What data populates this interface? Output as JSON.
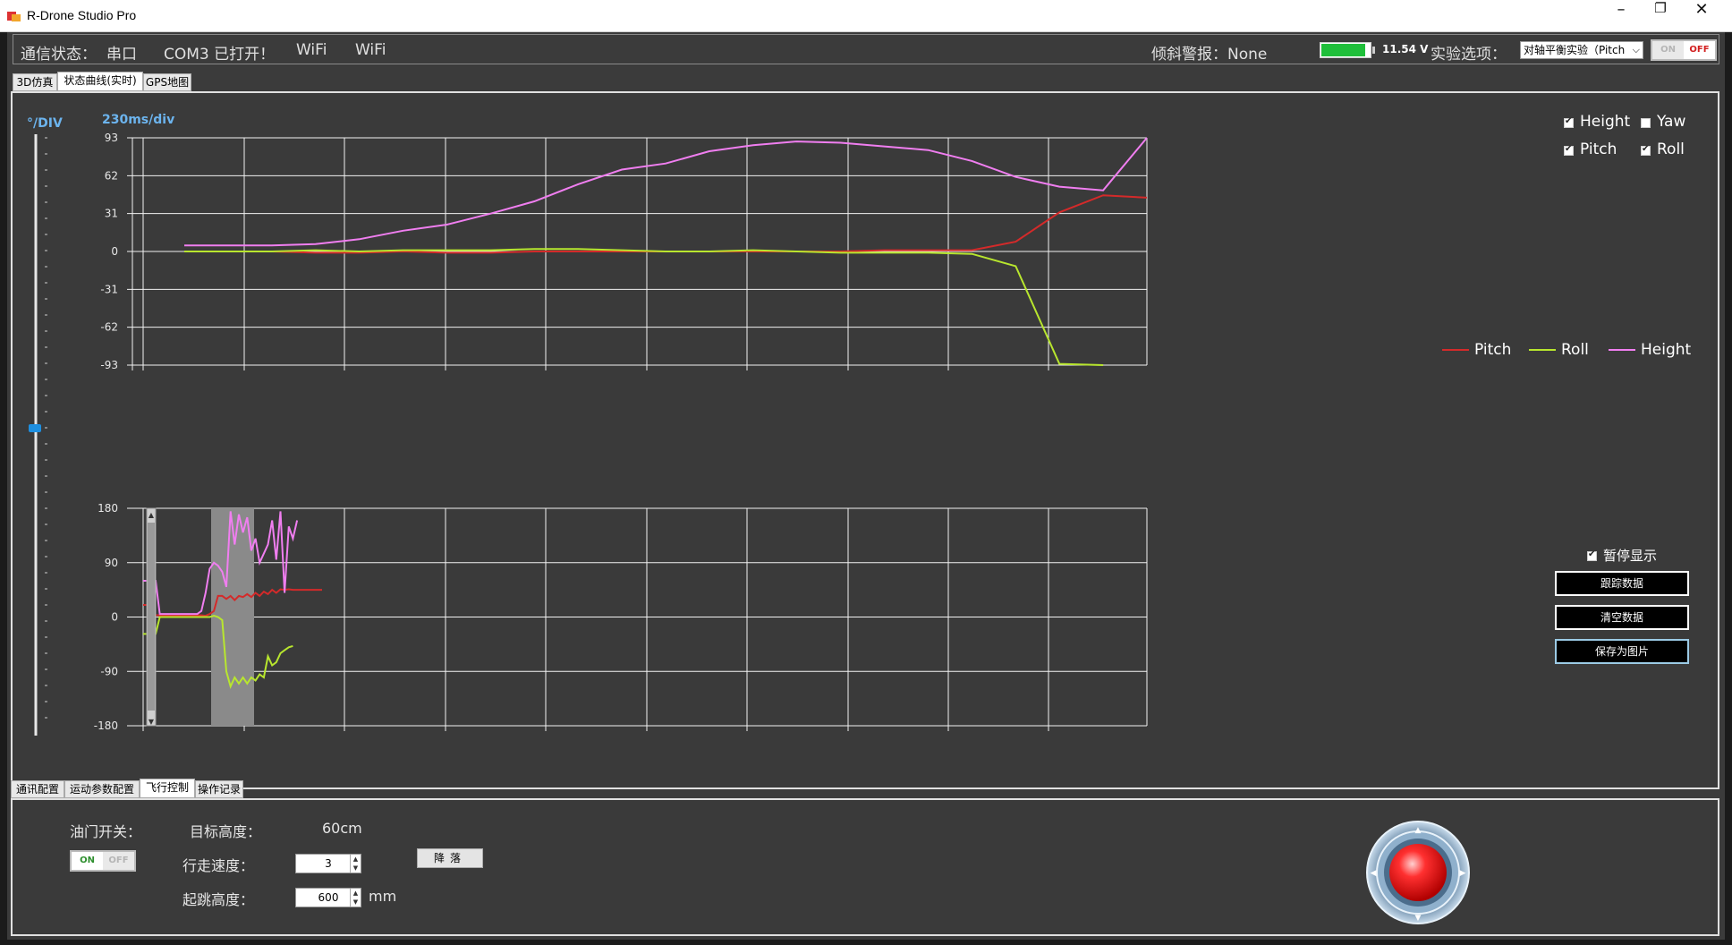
{
  "window": {
    "title": "R-Drone Studio  Pro",
    "minimize": "–",
    "restore": "❐",
    "close": "✕"
  },
  "status": {
    "comm_label": "通信状态：",
    "serial": "串口",
    "com_status": "COM3 已打开！",
    "wifi1": "WiFi",
    "wifi2": "WiFi",
    "tilt_alarm": "倾斜警报：None",
    "voltage": "11.54 V",
    "battery_level": 0.9,
    "experiment_label": "实验选项：",
    "experiment_value": "对轴平衡实验（Pitch",
    "toggle_on": "ON",
    "toggle_off": "OFF"
  },
  "top_tabs": [
    "3D仿真",
    "状态曲线(实时)",
    "GPS地图"
  ],
  "active_top_tab": 1,
  "chart_panel": {
    "unit_label": "°/DIV",
    "time_label": "230ms/div",
    "checkboxes": [
      {
        "label": "Height",
        "checked": true
      },
      {
        "label": "Yaw",
        "checked": false
      },
      {
        "label": "Pitch",
        "checked": true
      },
      {
        "label": "Roll",
        "checked": true
      }
    ],
    "pause_label": "暂停显示",
    "pause_checked": true,
    "buttons": [
      "跟踪数据",
      "清空数据",
      "保存为图片"
    ]
  },
  "chart_data": [
    {
      "type": "line",
      "title": "",
      "yticks": [
        "93",
        "62",
        "31",
        "0",
        "-31",
        "-62",
        "-93"
      ],
      "ylim": [
        -93,
        93
      ],
      "x": [
        0,
        1,
        2,
        3,
        4,
        5,
        6,
        7,
        8,
        9,
        10,
        11,
        12,
        13,
        14,
        15,
        16,
        17,
        18,
        19,
        20,
        21,
        22
      ],
      "legend": [
        "Pitch",
        "Roll",
        "Height"
      ],
      "colors": {
        "Pitch": "#d42a2a",
        "Roll": "#b8e62e",
        "Height": "#f07ef0"
      },
      "series": [
        {
          "name": "Pitch",
          "values": [
            0,
            0,
            0,
            -1,
            -1,
            0,
            -1,
            -1,
            0,
            0,
            0,
            0,
            0,
            0,
            0,
            0,
            1,
            1,
            1,
            8,
            32,
            46,
            44
          ]
        },
        {
          "name": "Roll",
          "values": [
            0,
            0,
            0,
            1,
            0,
            1,
            1,
            1,
            2,
            2,
            1,
            0,
            0,
            1,
            0,
            -1,
            -1,
            -1,
            -2,
            -12,
            -92,
            -93,
            null
          ]
        },
        {
          "name": "Height",
          "values": [
            5,
            5,
            5,
            6,
            10,
            17,
            22,
            31,
            41,
            55,
            67,
            72,
            82,
            87,
            90,
            89,
            86,
            83,
            74,
            61,
            53,
            50,
            93
          ]
        }
      ]
    },
    {
      "type": "line",
      "title": "",
      "yticks": [
        "180",
        "90",
        "0",
        "-90",
        "-180"
      ],
      "ylim": [
        -180,
        180
      ],
      "x": [
        0,
        1,
        2,
        3,
        4,
        5,
        6,
        7,
        8,
        9,
        10,
        11,
        12,
        13,
        14,
        15,
        16,
        17,
        18,
        19,
        20,
        21,
        22,
        23,
        24,
        25,
        26,
        27,
        28,
        29,
        30,
        31,
        32,
        33,
        34,
        35,
        36,
        37,
        38,
        39,
        40,
        41,
        42,
        43
      ],
      "colors": {
        "Pitch": "#d42a2a",
        "Roll": "#b8e62e",
        "Height": "#f07ef0"
      },
      "series": [
        {
          "name": "Pitch",
          "values": [
            20,
            20,
            20,
            3,
            3,
            3,
            3,
            3,
            3,
            3,
            3,
            3,
            3,
            3,
            3,
            2,
            5,
            10,
            35,
            35,
            30,
            35,
            28,
            35,
            33,
            38,
            33,
            40,
            35,
            42,
            38,
            45,
            40,
            46,
            45,
            46,
            45,
            45,
            45,
            45,
            45,
            45,
            45,
            45
          ]
        },
        {
          "name": "Roll",
          "values": [
            -28,
            -28,
            -28,
            -28,
            0,
            0,
            0,
            0,
            0,
            0,
            0,
            0,
            0,
            0,
            0,
            0,
            0,
            2,
            0,
            -5,
            -90,
            -115,
            -100,
            -110,
            -100,
            -110,
            -100,
            -105,
            -95,
            -100,
            -65,
            -80,
            -75,
            -60,
            -55,
            -50,
            -48,
            null,
            null,
            null,
            null,
            null,
            null,
            null
          ]
        },
        {
          "name": "Height",
          "values": [
            60,
            60,
            60,
            60,
            5,
            5,
            5,
            5,
            5,
            5,
            5,
            5,
            5,
            5,
            10,
            40,
            80,
            90,
            85,
            75,
            50,
            175,
            120,
            170,
            140,
            165,
            110,
            130,
            90,
            105,
            120,
            160,
            95,
            175,
            40,
            150,
            130,
            160,
            null,
            null,
            null,
            null,
            null,
            null
          ]
        }
      ]
    }
  ],
  "bottom_tabs": [
    "通讯配置",
    "运动参数配置",
    "飞行控制",
    "操作记录"
  ],
  "active_bottom_tab": 2,
  "flight": {
    "throttle_label": "油门开关：",
    "throttle_on": "ON",
    "throttle_off": "OFF",
    "target_height_label": "目标高度：",
    "target_height_value": "60cm",
    "land_button": "降落",
    "speed_label": "行走速度：",
    "speed_value": "3",
    "takeoff_label": "起跳高度：",
    "takeoff_value": "600",
    "takeoff_unit": "mm"
  }
}
